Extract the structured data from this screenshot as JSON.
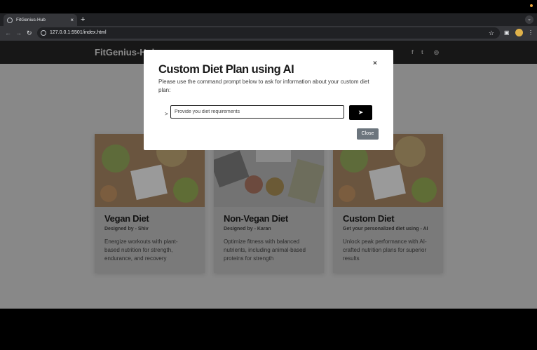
{
  "browser": {
    "tab_title": "FitGenius-Hub",
    "tab_close": "×",
    "new_tab": "+",
    "url": "127.0.0.1:5501/index.html",
    "back": "←",
    "forward": "→",
    "reload": "↻",
    "star": "☆",
    "tabs_menu": "⌄",
    "menu": "⋮"
  },
  "site": {
    "brand": "FitGenius-Hub",
    "social": [
      "f",
      "t",
      "◎"
    ]
  },
  "cards": [
    {
      "title": "Vegan Diet",
      "subtitle": "Designed by - Shiv",
      "text": "Energize workouts with plant-based nutrition for strength, endurance, and recovery"
    },
    {
      "title": "Non-Vegan Diet",
      "subtitle": "Designed by - Karan",
      "text": "Optimize fitness with balanced nutrients, including animal-based proteins for strength"
    },
    {
      "title": "Custom Diet",
      "subtitle": "Get your personalized diet using - AI",
      "text": "Unlock peak performance with AI-crafted nutrition plans for superior results"
    }
  ],
  "modal": {
    "title": "Custom Diet Plan using AI",
    "close_x": "×",
    "description": "Please use the command prompt below to ask for information about your custom diet plan:",
    "prompt_mark": ">",
    "input_placeholder": "Provide you diet requirements",
    "send_icon": "➤",
    "close_label": "Close"
  }
}
